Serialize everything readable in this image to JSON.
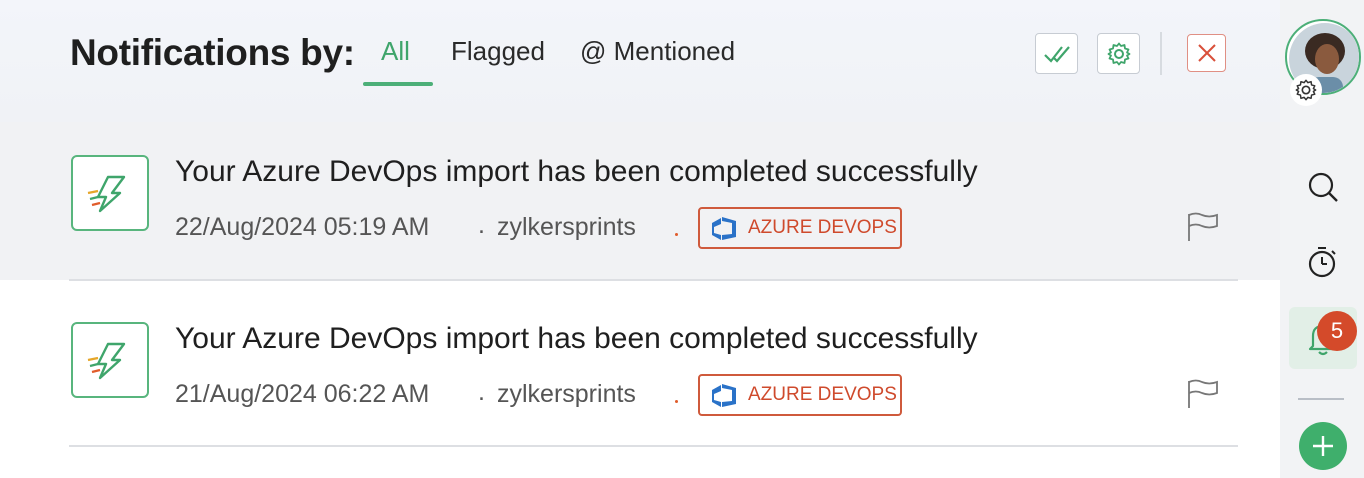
{
  "header": {
    "title": "Notifications by:",
    "tabs": [
      {
        "label": "All",
        "active": true
      },
      {
        "label": "Flagged",
        "active": false
      },
      {
        "label": "@ Mentioned",
        "active": false
      }
    ],
    "actions": {
      "mark_all_read_icon": "double-check-icon",
      "settings_icon": "gear-icon",
      "close_icon": "close-icon"
    }
  },
  "notifications": [
    {
      "message": "Your Azure DevOps import has been completed successfully",
      "date": "22/Aug/2024 05:19 AM",
      "separator": ".",
      "workspace": "zylkersprints",
      "source_badge": "AZURE DEVOPS"
    },
    {
      "message": "Your Azure DevOps import has been completed successfully",
      "date": "21/Aug/2024 06:22 AM",
      "separator": ".",
      "workspace": "zylkersprints",
      "source_badge": "AZURE DEVOPS"
    }
  ],
  "sidebar": {
    "notification_count": "5",
    "icons": [
      "search-icon",
      "timer-icon",
      "bell-icon",
      "plus-icon"
    ]
  },
  "colors": {
    "accent_green": "#3fa56b",
    "badge_red": "#cf4a2c",
    "count_red": "#d44a2a",
    "azure_blue": "#2a72c8"
  }
}
